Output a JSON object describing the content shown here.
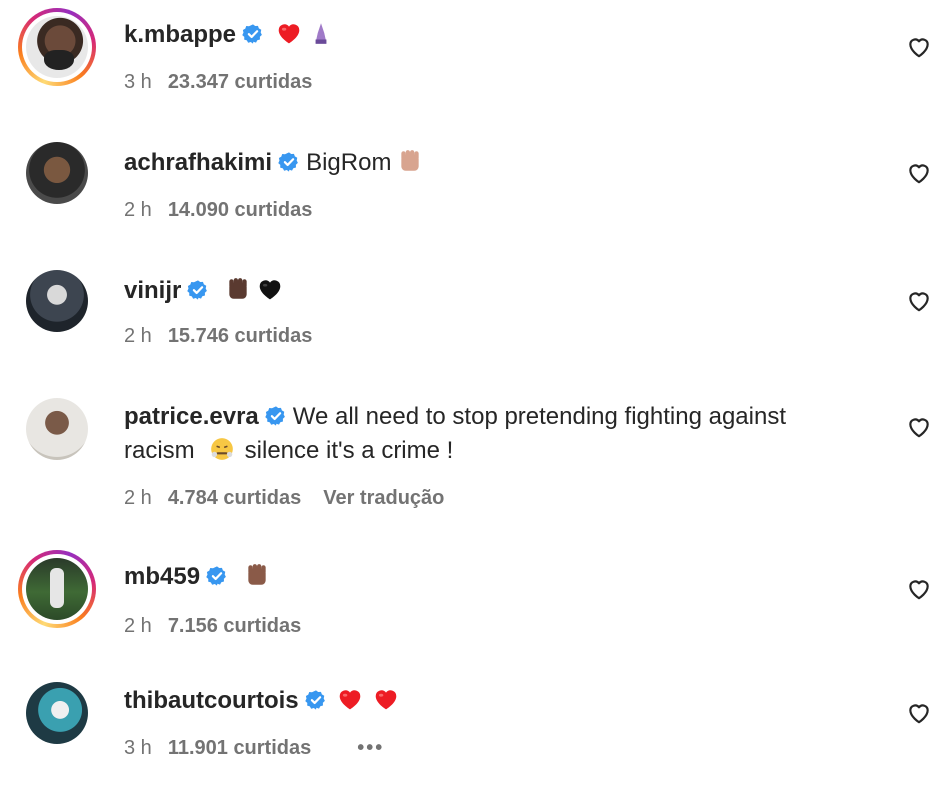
{
  "comments": [
    {
      "username": "k.mbappe",
      "text": "",
      "emojis": [
        "red-heart",
        "praying-hands"
      ],
      "time": "3 h",
      "likes": "23.347 curtidas",
      "story_ring": true
    },
    {
      "username": "achrafhakimi",
      "text": "BigRom",
      "emojis": [
        "raised-fist-light"
      ],
      "time": "2 h",
      "likes": "14.090 curtidas",
      "story_ring": false
    },
    {
      "username": "vinijr",
      "text": "",
      "emojis": [
        "raised-fist-dark",
        "black-heart"
      ],
      "time": "2 h",
      "likes": "15.746 curtidas",
      "story_ring": false
    },
    {
      "username": "patrice.evra",
      "text": "We all need to stop pretending fighting against",
      "text_line2_a": "racism",
      "text_line2_b": "silence it's a crime !",
      "emojis": [
        "face-with-steam"
      ],
      "time": "2 h",
      "likes": "4.784 curtidas",
      "translate": "Ver tradução",
      "story_ring": false
    },
    {
      "username": "mb459",
      "text": "",
      "emojis": [
        "raised-fist-medium"
      ],
      "time": "2 h",
      "likes": "7.156 curtidas",
      "story_ring": true
    },
    {
      "username": "thibautcourtois",
      "text": "",
      "emojis": [
        "red-heart",
        "red-heart"
      ],
      "time": "3 h",
      "likes": "11.901 curtidas",
      "more": "•••",
      "story_ring": false
    }
  ],
  "colors": {
    "verified": "#3897f0",
    "heart": "#ed1c24",
    "meta": "#737373",
    "text": "#262626"
  }
}
